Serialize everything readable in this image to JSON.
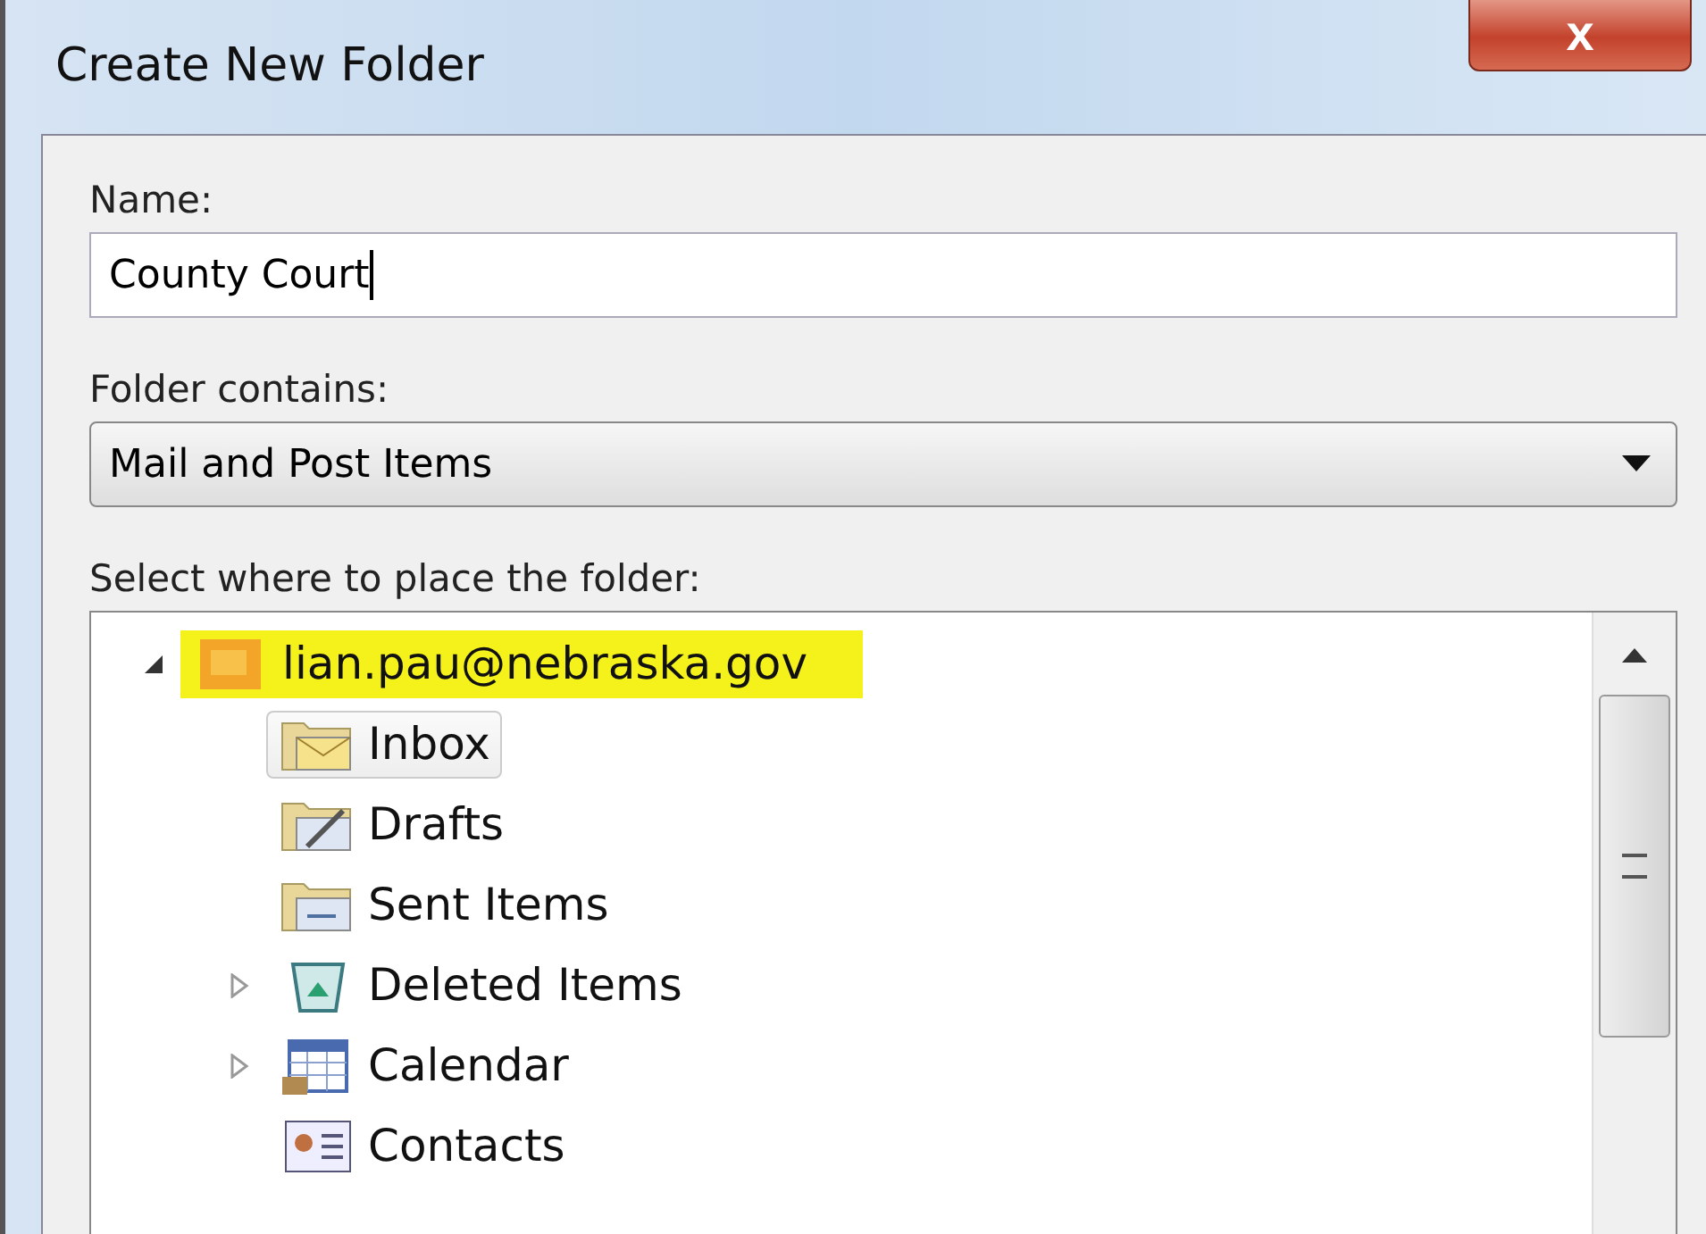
{
  "window": {
    "title": "Create New Folder",
    "close_label": "x"
  },
  "name_field": {
    "label": "Name:",
    "value": "County Court"
  },
  "contains_field": {
    "label": "Folder contains:",
    "value": "Mail and Post Items"
  },
  "tree": {
    "label": "Select where to place the folder:",
    "items": [
      {
        "label": "lian.pau@nebraska.gov",
        "kind": "account",
        "expanded": true,
        "highlighted": true,
        "selected": false,
        "children": [
          {
            "label": "Inbox",
            "kind": "inbox",
            "selected": true
          },
          {
            "label": "Drafts",
            "kind": "drafts",
            "selected": false
          },
          {
            "label": "Sent Items",
            "kind": "sent",
            "selected": false
          },
          {
            "label": "Deleted Items",
            "kind": "deleted",
            "expanded": false,
            "selected": false
          },
          {
            "label": "Calendar",
            "kind": "calendar",
            "expanded": false,
            "selected": false
          },
          {
            "label": "Contacts",
            "kind": "contacts",
            "selected": false
          }
        ]
      }
    ]
  }
}
